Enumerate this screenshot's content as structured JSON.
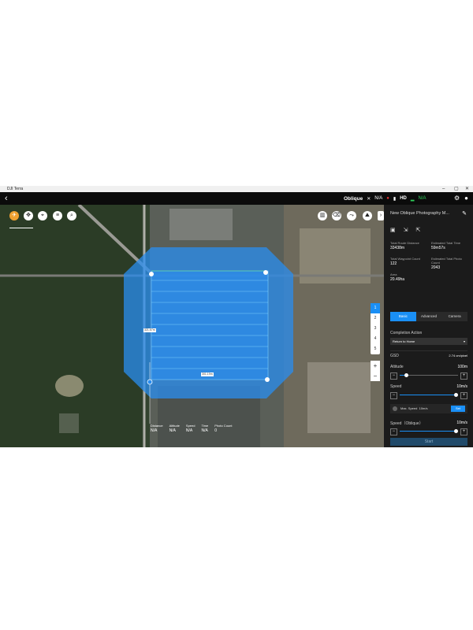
{
  "window": {
    "title": "DJI Terra",
    "controls": [
      "–",
      "▢",
      "✕"
    ]
  },
  "topbar": {
    "back": "‹",
    "mode": "Oblique",
    "na1": "N/A",
    "na2": "N/A",
    "hd": "HD",
    "icons": [
      "gear-icon",
      "user-icon"
    ]
  },
  "map": {
    "tools_left": [
      "compass-icon",
      "move-icon",
      "pin-icon",
      "list-icon",
      "search-icon"
    ],
    "tools_right": [
      "trash-icon",
      "eraser-icon",
      "route-icon",
      "terrain-icon"
    ],
    "dim_left": "321.57m",
    "dim_bottom": "301.19m",
    "views": [
      "1",
      "2",
      "3",
      "4",
      "5"
    ],
    "active_view": "1",
    "zoom_in": "+",
    "zoom_out": "−"
  },
  "stats": [
    {
      "label": "Distance",
      "value": "N/A"
    },
    {
      "label": "Altitude",
      "value": "N/A"
    },
    {
      "label": "Speed",
      "value": "N/A"
    },
    {
      "label": "Time",
      "value": "N/A"
    },
    {
      "label": "Photo Count",
      "value": "0"
    }
  ],
  "panel": {
    "title": "New Oblique Photography M...",
    "route_distance_label": "Total Route Distance",
    "route_distance": "33438m",
    "est_time_label": "Estimated Total Time",
    "est_time": "59m57s",
    "waypoint_label": "Total Waypoint Count",
    "waypoint": "122",
    "photo_label": "Estimated Total Photo Count",
    "photo": "2043",
    "area_label": "Area",
    "area": "20.49ha",
    "tabs": [
      "Basic",
      "Advanced",
      "Camera"
    ],
    "completion_label": "Completion Action",
    "completion_value": "Return to Home",
    "gsd_label": "GSD",
    "gsd_value": "2.74 cm/pixel",
    "altitude_label": "Altitude",
    "altitude_value": "100m",
    "altitude_level": 0.12,
    "speed_label": "Speed",
    "speed_value": "10m/s",
    "speed_level": 0.97,
    "max_speed_label": "Max. Speed",
    "max_speed_value": "10m/s",
    "set_label": "Set",
    "speed_oblique_label": "Speed（Oblique）",
    "speed_oblique_value": "10m/s",
    "speed_oblique_level": 0.97,
    "start_label": "Start"
  },
  "colors": {
    "accent": "#1a8ff5",
    "area_fill": "#2a8ef0"
  }
}
